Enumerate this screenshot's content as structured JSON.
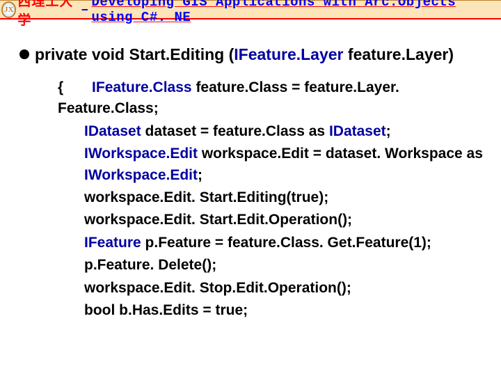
{
  "header": {
    "cn_text": "西理工大学",
    "dash": " – ",
    "en_text": "Developing GIS Applications with Arc.Objects using C#. NE"
  },
  "signature": {
    "keyword1": "private void ",
    "method": "Start.Editing (",
    "paramType": "IFeature.Layer",
    "paramName": " feature.Layer)"
  },
  "code": {
    "l1_brace": "{",
    "l1_a": "IFeature.Class",
    "l1_b": " feature.Class = feature.Layer. Feature.Class; ",
    "l2_a": "IDataset",
    "l2_b": " dataset = feature.Class as ",
    "l2_c": "IDataset",
    "l2_d": "; ",
    "l3_a": "IWorkspace.Edit",
    "l3_b": " workspace.Edit = dataset. Workspace as ",
    "l3_c": "IWorkspace.Edit",
    "l3_d": "; ",
    "l4": "workspace.Edit. Start.Editing(true); ",
    "l5": "workspace.Edit. Start.Edit.Operation(); ",
    "l6_a": "IFeature",
    "l6_b": " p.Feature = feature.Class. Get.Feature(1); ",
    "l7": "p.Feature. Delete(); ",
    "l8": "workspace.Edit. Stop.Edit.Operation(); ",
    "l9": "bool b.Has.Edits = true;"
  }
}
